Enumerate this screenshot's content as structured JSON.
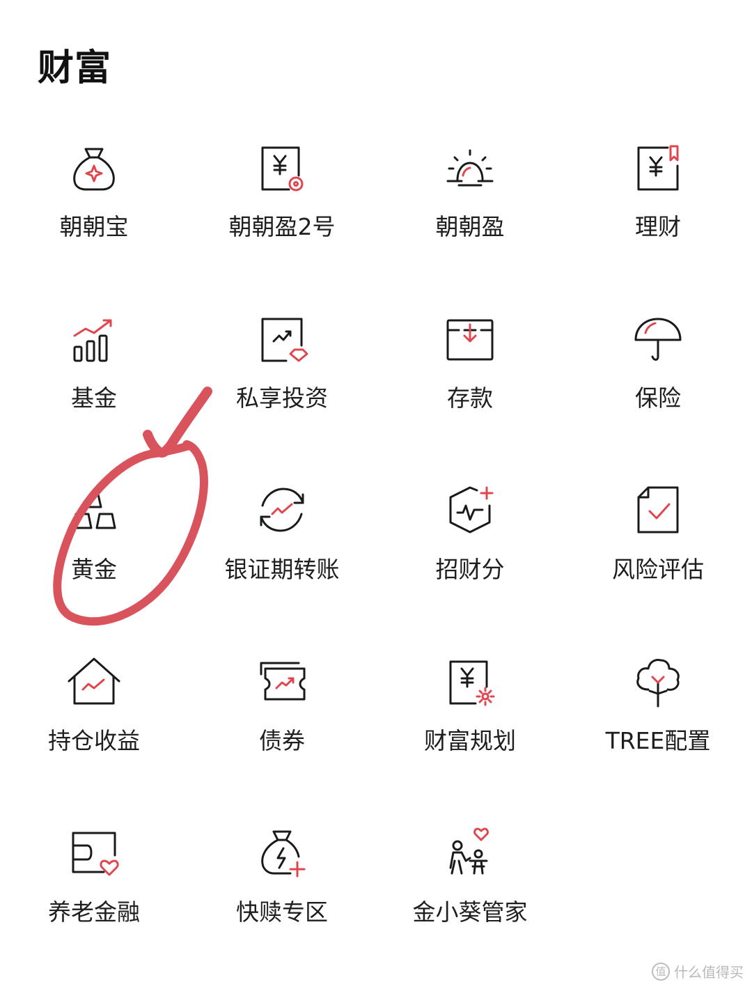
{
  "header": {
    "title": "财富"
  },
  "colors": {
    "accent": "#e0464e",
    "stroke": "#1a1a1a",
    "annotation": "#d9535d"
  },
  "items": [
    {
      "label": "朝朝宝",
      "icon": "money-bag-icon"
    },
    {
      "label": "朝朝盈2号",
      "icon": "yuan-doc-coin-icon"
    },
    {
      "label": "朝朝盈",
      "icon": "sunrise-icon"
    },
    {
      "label": "理财",
      "icon": "yuan-doc-bookmark-icon"
    },
    {
      "label": "基金",
      "icon": "bar-chart-trend-icon"
    },
    {
      "label": "私享投资",
      "icon": "chart-diamond-icon"
    },
    {
      "label": "存款",
      "icon": "deposit-box-icon"
    },
    {
      "label": "保险",
      "icon": "umbrella-icon"
    },
    {
      "label": "黄金",
      "icon": "gold-bars-icon"
    },
    {
      "label": "银证期转账",
      "icon": "transfer-cycle-icon"
    },
    {
      "label": "招财分",
      "icon": "score-hexagon-icon"
    },
    {
      "label": "风险评估",
      "icon": "check-document-icon"
    },
    {
      "label": "持仓收益",
      "icon": "house-trend-icon"
    },
    {
      "label": "债券",
      "icon": "bond-ticket-icon"
    },
    {
      "label": "财富规划",
      "icon": "yuan-doc-flower-icon"
    },
    {
      "label": "TREE配置",
      "icon": "tree-icon"
    },
    {
      "label": "养老金融",
      "icon": "pension-card-icon"
    },
    {
      "label": "快赎专区",
      "icon": "quick-redeem-bag-icon"
    },
    {
      "label": "金小葵管家",
      "icon": "family-heart-icon"
    }
  ],
  "watermark": {
    "text": "什么值得买",
    "logo": "值"
  }
}
